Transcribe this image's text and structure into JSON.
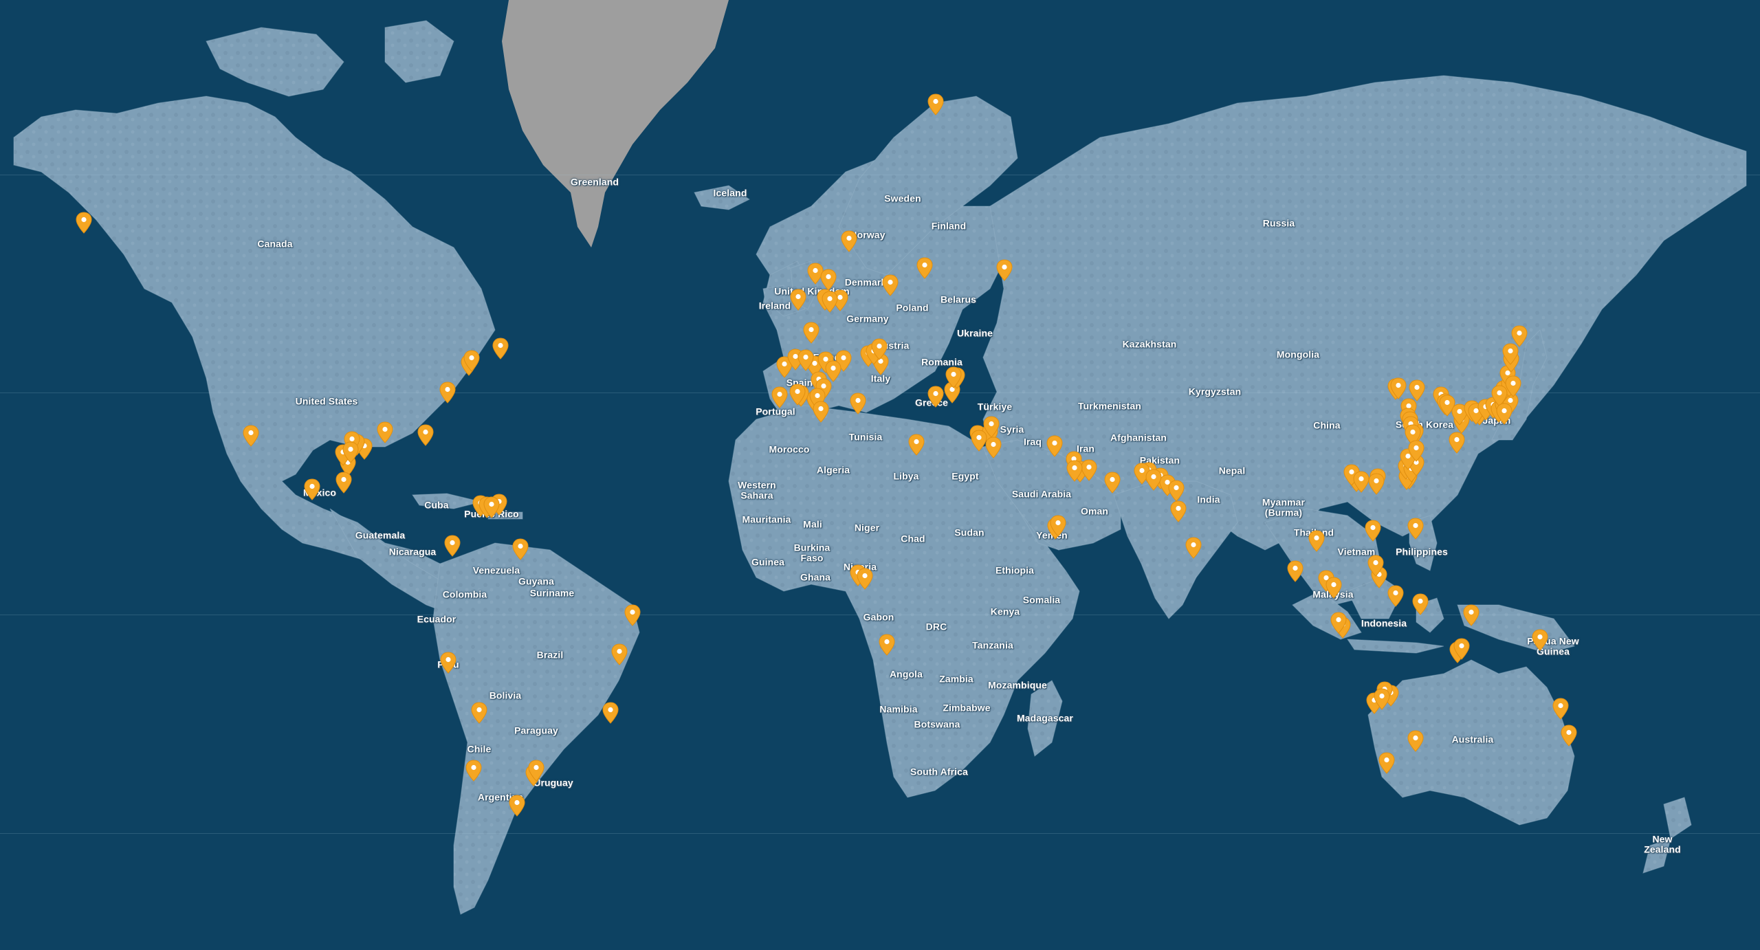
{
  "map": {
    "colors": {
      "ocean": "#0d4262",
      "land": "#7e9fb7",
      "land_dark": "#6b8ca4",
      "land_light": "#9bbad0",
      "greenland": "#9e9e9e",
      "pin": "#f5a623",
      "pin_dot": "#ffffff",
      "label": "#ffffff"
    },
    "labels": [
      {
        "id": "greenland",
        "text": "Greenland"
      },
      {
        "id": "iceland",
        "text": "Iceland"
      },
      {
        "id": "canada",
        "text": "Canada"
      },
      {
        "id": "united-states",
        "text": "United States"
      },
      {
        "id": "mexico",
        "text": "Mexico"
      },
      {
        "id": "cuba",
        "text": "Cuba"
      },
      {
        "id": "puerto-rico",
        "text": "Puerto Rico"
      },
      {
        "id": "guatemala",
        "text": "Guatemala"
      },
      {
        "id": "nicaragua",
        "text": "Nicaragua"
      },
      {
        "id": "venezuela",
        "text": "Venezuela"
      },
      {
        "id": "guyana",
        "text": "Guyana"
      },
      {
        "id": "suriname",
        "text": "Suriname"
      },
      {
        "id": "colombia",
        "text": "Colombia"
      },
      {
        "id": "ecuador",
        "text": "Ecuador"
      },
      {
        "id": "brazil",
        "text": "Brazil"
      },
      {
        "id": "peru",
        "text": "Peru"
      },
      {
        "id": "bolivia",
        "text": "Bolivia"
      },
      {
        "id": "paraguay",
        "text": "Paraguay"
      },
      {
        "id": "chile",
        "text": "Chile"
      },
      {
        "id": "argentina",
        "text": "Argentina"
      },
      {
        "id": "uruguay",
        "text": "Uruguay"
      },
      {
        "id": "sweden",
        "text": "Sweden"
      },
      {
        "id": "finland",
        "text": "Finland"
      },
      {
        "id": "norway",
        "text": "Norway"
      },
      {
        "id": "denmark",
        "text": "Denmark"
      },
      {
        "id": "united-kingdom",
        "text": "United Kingdom"
      },
      {
        "id": "ireland",
        "text": "Ireland"
      },
      {
        "id": "poland",
        "text": "Poland"
      },
      {
        "id": "belarus",
        "text": "Belarus"
      },
      {
        "id": "germany",
        "text": "Germany"
      },
      {
        "id": "ukraine",
        "text": "Ukraine"
      },
      {
        "id": "austria",
        "text": "Austria"
      },
      {
        "id": "france",
        "text": "France"
      },
      {
        "id": "romania",
        "text": "Romania"
      },
      {
        "id": "italy",
        "text": "Italy"
      },
      {
        "id": "spain",
        "text": "Spain"
      },
      {
        "id": "portugal",
        "text": "Portugal"
      },
      {
        "id": "greece",
        "text": "Greece"
      },
      {
        "id": "turkiye",
        "text": "Türkiye"
      },
      {
        "id": "syria",
        "text": "Syria"
      },
      {
        "id": "tunisia",
        "text": "Tunisia"
      },
      {
        "id": "morocco",
        "text": "Morocco"
      },
      {
        "id": "algeria",
        "text": "Algeria"
      },
      {
        "id": "libya",
        "text": "Libya"
      },
      {
        "id": "egypt",
        "text": "Egypt"
      },
      {
        "id": "western-sahara",
        "text": "Western\nSahara"
      },
      {
        "id": "mauritania",
        "text": "Mauritania"
      },
      {
        "id": "mali",
        "text": "Mali"
      },
      {
        "id": "niger",
        "text": "Niger"
      },
      {
        "id": "chad",
        "text": "Chad"
      },
      {
        "id": "sudan",
        "text": "Sudan"
      },
      {
        "id": "burkina-faso",
        "text": "Burkina\nFaso"
      },
      {
        "id": "guinea",
        "text": "Guinea"
      },
      {
        "id": "ghana",
        "text": "Ghana"
      },
      {
        "id": "nigeria",
        "text": "Nigeria"
      },
      {
        "id": "ethiopia",
        "text": "Ethiopia"
      },
      {
        "id": "somalia",
        "text": "Somalia"
      },
      {
        "id": "kenya",
        "text": "Kenya"
      },
      {
        "id": "gabon",
        "text": "Gabon"
      },
      {
        "id": "drc",
        "text": "DRC"
      },
      {
        "id": "tanzania",
        "text": "Tanzania"
      },
      {
        "id": "angola",
        "text": "Angola"
      },
      {
        "id": "zambia",
        "text": "Zambia"
      },
      {
        "id": "mozambique",
        "text": "Mozambique"
      },
      {
        "id": "namibia",
        "text": "Namibia"
      },
      {
        "id": "zimbabwe",
        "text": "Zimbabwe"
      },
      {
        "id": "botswana",
        "text": "Botswana"
      },
      {
        "id": "madagascar",
        "text": "Madagascar"
      },
      {
        "id": "south-africa",
        "text": "South Africa"
      },
      {
        "id": "iraq",
        "text": "Iraq"
      },
      {
        "id": "iran",
        "text": "Iran"
      },
      {
        "id": "saudi-arabia",
        "text": "Saudi Arabia"
      },
      {
        "id": "oman",
        "text": "Oman"
      },
      {
        "id": "yemen",
        "text": "Yemen"
      },
      {
        "id": "russia",
        "text": "Russia"
      },
      {
        "id": "kazakhstan",
        "text": "Kazakhstan"
      },
      {
        "id": "turkmenistan",
        "text": "Turkmenistan"
      },
      {
        "id": "kyrgyzstan",
        "text": "Kyrgyzstan"
      },
      {
        "id": "afghanistan",
        "text": "Afghanistan"
      },
      {
        "id": "pakistan",
        "text": "Pakistan"
      },
      {
        "id": "nepal",
        "text": "Nepal"
      },
      {
        "id": "india",
        "text": "India"
      },
      {
        "id": "mongolia",
        "text": "Mongolia"
      },
      {
        "id": "china",
        "text": "China"
      },
      {
        "id": "south-korea",
        "text": "South Korea"
      },
      {
        "id": "japan",
        "text": "Japan"
      },
      {
        "id": "myanmar",
        "text": "Myanmar\n(Burma)"
      },
      {
        "id": "thailand",
        "text": "Thailand"
      },
      {
        "id": "vietnam",
        "text": "Vietnam"
      },
      {
        "id": "philippines",
        "text": "Philippines"
      },
      {
        "id": "malaysia",
        "text": "Malaysia"
      },
      {
        "id": "indonesia",
        "text": "Indonesia"
      },
      {
        "id": "papua-new-guinea",
        "text": "Papua New\nGuinea"
      },
      {
        "id": "australia",
        "text": "Australia"
      },
      {
        "id": "new-zealand",
        "text": "New\nZealand"
      }
    ],
    "pin_count": 162
  }
}
